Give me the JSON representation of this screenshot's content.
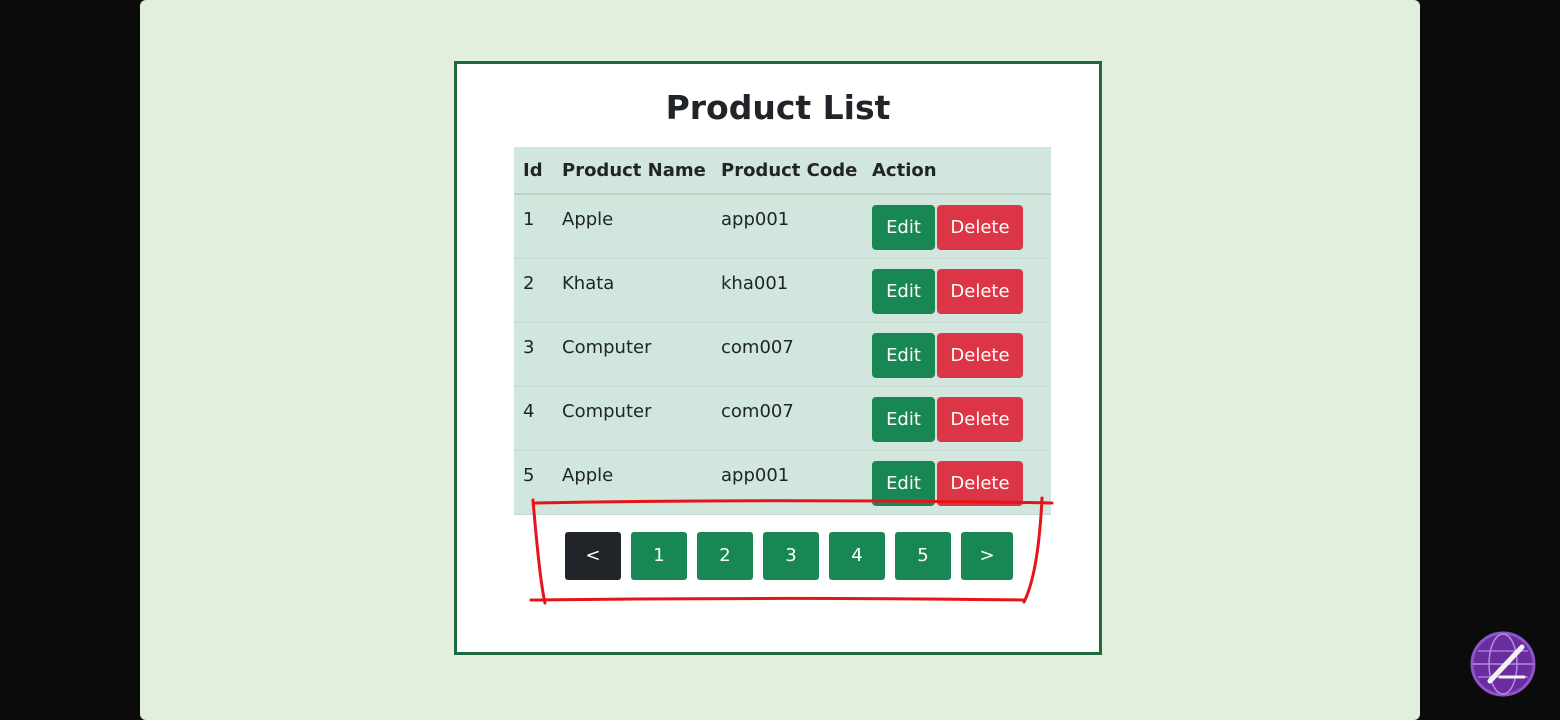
{
  "page": {
    "title": "Product List"
  },
  "table": {
    "headers": [
      "Id",
      "Product Name",
      "Product Code",
      "Action"
    ],
    "rows": [
      {
        "id": "1",
        "name": "Apple",
        "code": "app001"
      },
      {
        "id": "2",
        "name": "Khata",
        "code": "kha001"
      },
      {
        "id": "3",
        "name": "Computer",
        "code": "com007"
      },
      {
        "id": "4",
        "name": "Computer",
        "code": "com007"
      },
      {
        "id": "5",
        "name": "Apple",
        "code": "app001"
      }
    ],
    "edit_label": "Edit",
    "delete_label": "Delete"
  },
  "pagination": {
    "prev_label": "<",
    "pages": [
      "1",
      "2",
      "3",
      "4",
      "5"
    ],
    "next_label": ">"
  },
  "colors": {
    "stage_background": "#e2efdf",
    "card_border": "#1e6b3f",
    "table_background": "#d1e7dd",
    "edit_button": "#198754",
    "delete_button": "#dc3545",
    "prev_button": "#212529",
    "page_button": "#198754",
    "annotation_stroke": "#e5141b"
  },
  "icons": {
    "watermark": "globe-logo-icon"
  }
}
